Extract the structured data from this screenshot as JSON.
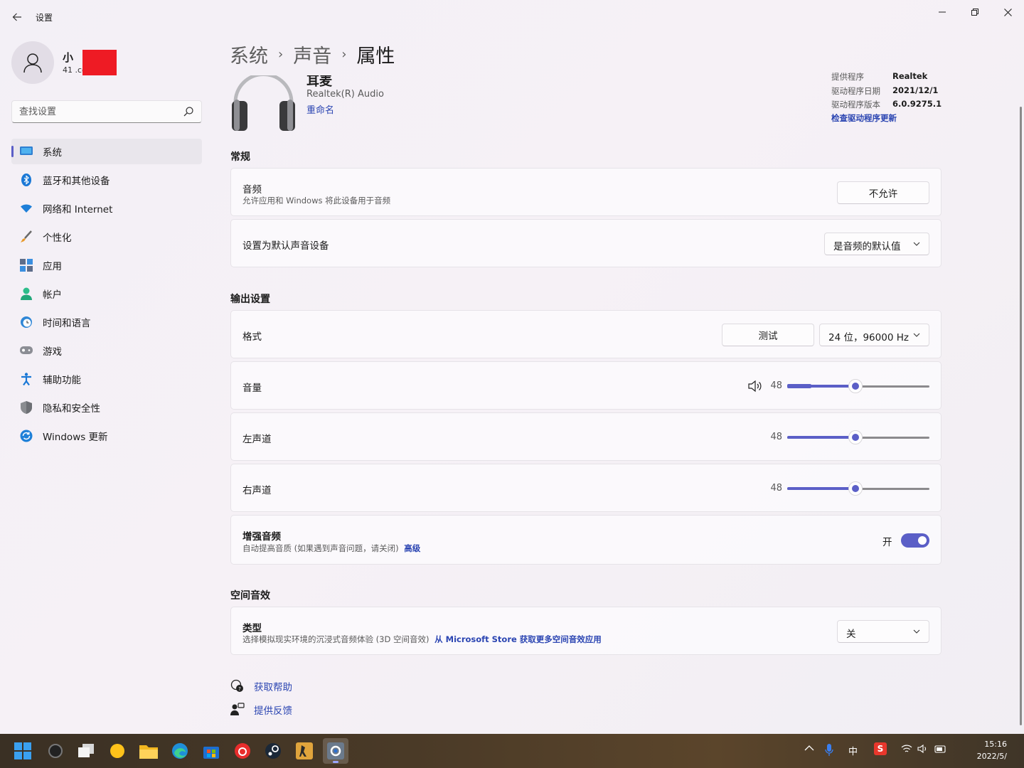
{
  "app": {
    "title": "设置"
  },
  "profile": {
    "name": "小",
    "email": "41 .com"
  },
  "search": {
    "placeholder": "查找设置"
  },
  "nav": {
    "items": [
      {
        "label": "系统",
        "icon": "system-icon",
        "active": true
      },
      {
        "label": "蓝牙和其他设备",
        "icon": "bluetooth-icon"
      },
      {
        "label": "网络和 Internet",
        "icon": "wifi-icon"
      },
      {
        "label": "个性化",
        "icon": "brush-icon"
      },
      {
        "label": "应用",
        "icon": "apps-icon"
      },
      {
        "label": "帐户",
        "icon": "account-icon"
      },
      {
        "label": "时间和语言",
        "icon": "clock-globe-icon"
      },
      {
        "label": "游戏",
        "icon": "gamepad-icon"
      },
      {
        "label": "辅助功能",
        "icon": "accessibility-icon"
      },
      {
        "label": "隐私和安全性",
        "icon": "shield-icon"
      },
      {
        "label": "Windows 更新",
        "icon": "update-icon"
      }
    ]
  },
  "breadcrumb": {
    "items": [
      "系统",
      "声音",
      "属性"
    ],
    "separator": "›"
  },
  "device": {
    "name": "耳麦",
    "subtitle": "Realtek(R) Audio",
    "rename": "重命名",
    "icon": "headphones-icon"
  },
  "driver": {
    "provider_label": "提供程序",
    "provider_value": "Realtek",
    "date_label": "驱动程序日期",
    "date_value": "2021/12/1",
    "version_label": "驱动程序版本",
    "version_value": "6.0.9275.1",
    "update_link": "检查驱动程序更新"
  },
  "general": {
    "section_title": "常规",
    "audio": {
      "title": "音频",
      "desc": "允许应用和 Windows 将此设备用于音频",
      "button": "不允许"
    },
    "default_device": {
      "title": "设置为默认声音设备",
      "value": "是音频的默认值"
    }
  },
  "output": {
    "section_title": "输出设置",
    "format": {
      "title": "格式",
      "test_button": "测试",
      "value": "24 位，96000 Hz"
    },
    "volume": {
      "title": "音量",
      "value": "48",
      "level": 0.48
    },
    "left_channel": {
      "title": "左声道",
      "value": "48",
      "level": 0.48
    },
    "right_channel": {
      "title": "右声道",
      "value": "48",
      "level": 0.48
    },
    "enhance": {
      "title": "增强音频",
      "desc": "自动提高音质 (如果遇到声音问题，请关闭)",
      "link": "高级",
      "toggle_label": "开",
      "toggle_on": true
    }
  },
  "spatial": {
    "section_title": "空间音效",
    "type": {
      "title": "类型",
      "desc": "选择模拟现实环境的沉浸式音频体验 (3D 空间音效)",
      "link": "从 Microsoft Store 获取更多空间音效应用",
      "value": "关"
    }
  },
  "help": {
    "get_help": "获取帮助",
    "feedback": "提供反馈"
  },
  "taskbar": {
    "apps": [
      "start-icon",
      "search-app-icon",
      "task-view-icon",
      "yellow-app-icon",
      "file-explorer-icon",
      "edge-icon",
      "store-icon",
      "netease-music-icon",
      "steam-icon",
      "csgo-icon",
      "settings-icon"
    ],
    "tray": {
      "ime": "中",
      "sogou": "S"
    },
    "clock_time": "15:16",
    "clock_date": "2022/5/"
  },
  "colors": {
    "accent": "#5b5fc7",
    "link": "#2b45b2",
    "redaction": "#ee1b24"
  }
}
